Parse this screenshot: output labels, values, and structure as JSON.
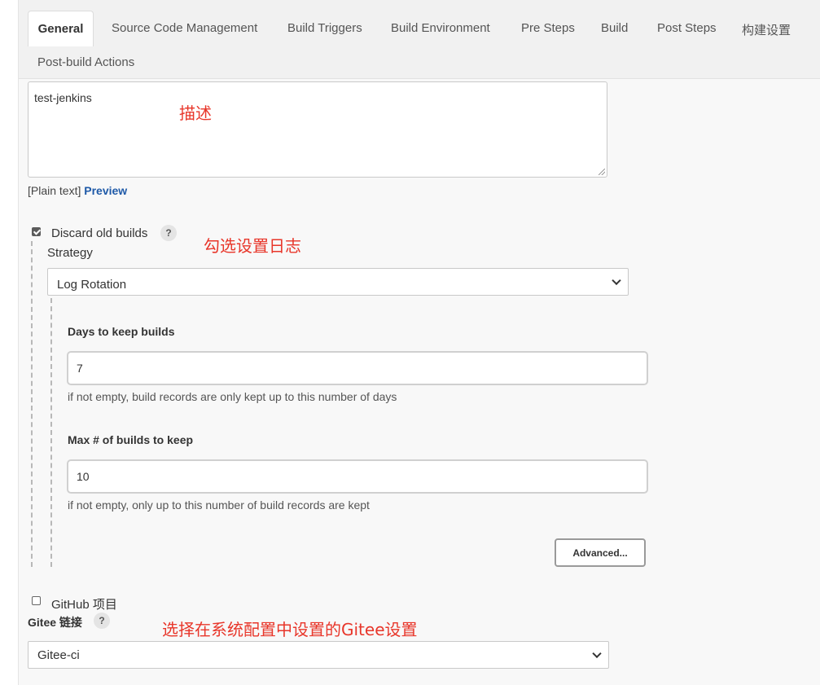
{
  "tabs": [
    {
      "label": "General",
      "active": true
    },
    {
      "label": "Source Code Management"
    },
    {
      "label": "Build Triggers"
    },
    {
      "label": "Build Environment"
    },
    {
      "label": "Pre Steps"
    },
    {
      "label": "Build"
    },
    {
      "label": "Post Steps"
    },
    {
      "label": "构建设置"
    },
    {
      "label": "Post-build Actions"
    }
  ],
  "description": {
    "value": "test-jenkins",
    "format_label": "[Plain text]",
    "preview_link": "Preview"
  },
  "discard_old_builds": {
    "label": "Discard old builds",
    "checked": true,
    "help": "?",
    "strategy_label": "Strategy",
    "strategy_value": "Log Rotation",
    "days_label": "Days to keep builds",
    "days_value": "7",
    "days_hint": "if not empty, build records are only kept up to this number of days",
    "max_label": "Max # of builds to keep",
    "max_value": "10",
    "max_hint": "if not empty, only up to this number of build records are kept",
    "advanced_button": "Advanced..."
  },
  "github_project": {
    "label": "GitHub 项目",
    "checked": false
  },
  "gitee": {
    "label": "Gitee 链接",
    "help": "?",
    "value": "Gitee-ci"
  },
  "annotations": {
    "description": "描述",
    "discard": "勾选设置日志",
    "gitee": "选择在系统配置中设置的Gitee设置"
  },
  "colors": {
    "annotation": "#e8362a",
    "link": "#1f5aa8"
  }
}
